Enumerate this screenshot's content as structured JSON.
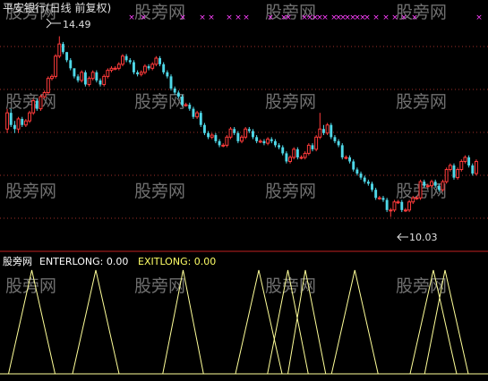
{
  "main_panel": {
    "title": "平安银行(日线 前复权)",
    "high_label": "14.49",
    "low_label": "10.03",
    "watermark": "股旁网",
    "marker_glyph": "×"
  },
  "indicator_panel": {
    "name": "股旁网",
    "enter_label": "ENTERLONG: 0.00",
    "exit_label": "EXITLONG: 0.00"
  },
  "colors": {
    "background": "#000000",
    "up_candle": "#ff3b3b",
    "down_candle": "#4fd8e8",
    "title": "#e0e0e0",
    "watermark": "#6f6f6f",
    "grid": "#a0302a",
    "panel_divider": "#c02020",
    "marker": "#ff40ff",
    "indicator_line": "#ffff99",
    "label_white": "#ffffff",
    "label_yellow": "#ffff66"
  },
  "chart_data": [
    {
      "type": "candlestick",
      "title": "平安银行(日线 前复权)",
      "y_range": [
        9.6,
        14.9
      ],
      "grid": true,
      "annotations": [
        {
          "text": "14.49",
          "value": 14.49,
          "kind": "high"
        },
        {
          "text": "10.03",
          "value": 10.03,
          "kind": "low"
        }
      ],
      "series": {
        "open": [
          12.2,
          12.6,
          12.3,
          12.2,
          12.45,
          12.3,
          12.4,
          12.6,
          12.9,
          12.7,
          13.0,
          13.1,
          13.45,
          13.5,
          14.0,
          14.3,
          14.1,
          13.9,
          13.7,
          13.5,
          13.4,
          13.6,
          13.3,
          13.45,
          13.6,
          13.4,
          13.3,
          13.5,
          13.65,
          13.7,
          13.7,
          13.8,
          14.0,
          13.9,
          13.85,
          13.6,
          13.55,
          13.6,
          13.75,
          13.7,
          13.8,
          13.95,
          13.8,
          13.6,
          13.5,
          13.2,
          13.1,
          13.0,
          12.8,
          12.8,
          12.7,
          12.5,
          12.6,
          12.3,
          12.1,
          12.0,
          12.05,
          11.9,
          11.8,
          11.8,
          12.0,
          12.2,
          12.1,
          11.9,
          12.0,
          12.2,
          12.15,
          12.0,
          11.9,
          11.9,
          11.85,
          11.95,
          11.9,
          11.8,
          11.75,
          11.6,
          11.4,
          11.5,
          11.7,
          11.5,
          11.5,
          11.6,
          11.8,
          11.7,
          12.0,
          12.2,
          12.1,
          12.3,
          12.0,
          11.9,
          11.8,
          11.5,
          11.5,
          11.4,
          11.2,
          11.1,
          11.0,
          10.9,
          10.85,
          10.7,
          10.5,
          10.5,
          10.45,
          10.2,
          10.2,
          10.4,
          10.4,
          10.2,
          10.2,
          10.4,
          10.5,
          10.5,
          10.9,
          10.8,
          10.8,
          10.9,
          10.8,
          10.7,
          10.9,
          11.2,
          11.3,
          11.0,
          11.2,
          11.4,
          11.5,
          11.3,
          11.1
        ],
        "close": [
          12.6,
          12.3,
          12.2,
          12.45,
          12.3,
          12.4,
          12.6,
          12.9,
          12.7,
          13.0,
          13.1,
          13.45,
          13.5,
          14.0,
          14.3,
          14.1,
          13.9,
          13.7,
          13.5,
          13.4,
          13.6,
          13.3,
          13.45,
          13.6,
          13.4,
          13.3,
          13.5,
          13.65,
          13.7,
          13.7,
          13.8,
          14.0,
          13.9,
          13.85,
          13.6,
          13.55,
          13.6,
          13.75,
          13.7,
          13.8,
          13.95,
          13.8,
          13.6,
          13.5,
          13.2,
          13.1,
          13.0,
          12.8,
          12.8,
          12.7,
          12.5,
          12.6,
          12.3,
          12.1,
          12.0,
          12.05,
          11.9,
          11.8,
          11.8,
          12.0,
          12.2,
          12.1,
          11.9,
          12.0,
          12.2,
          12.15,
          12.0,
          11.9,
          11.9,
          11.85,
          11.95,
          11.9,
          11.8,
          11.75,
          11.6,
          11.4,
          11.5,
          11.7,
          11.5,
          11.5,
          11.6,
          11.8,
          11.7,
          12.0,
          12.2,
          12.1,
          12.3,
          12.0,
          11.9,
          11.8,
          11.5,
          11.5,
          11.4,
          11.2,
          11.1,
          11.0,
          10.9,
          10.85,
          10.7,
          10.5,
          10.5,
          10.45,
          10.2,
          10.2,
          10.4,
          10.4,
          10.2,
          10.2,
          10.4,
          10.5,
          10.5,
          10.9,
          10.8,
          10.8,
          10.9,
          10.8,
          10.7,
          10.9,
          11.2,
          11.3,
          11.0,
          11.2,
          11.4,
          11.5,
          11.3,
          11.1,
          11.4
        ],
        "high": [
          12.7,
          12.7,
          12.4,
          12.5,
          12.5,
          12.45,
          12.65,
          12.95,
          12.95,
          13.05,
          13.15,
          13.5,
          13.55,
          14.05,
          14.49,
          14.35,
          14.1,
          13.95,
          13.7,
          13.55,
          13.65,
          13.65,
          13.5,
          13.65,
          13.65,
          13.45,
          13.55,
          13.7,
          13.75,
          13.75,
          13.85,
          14.05,
          14.05,
          13.95,
          13.9,
          13.65,
          13.65,
          13.8,
          13.8,
          13.85,
          14.0,
          14.0,
          13.85,
          13.65,
          13.55,
          13.25,
          13.15,
          13.05,
          12.85,
          12.85,
          12.75,
          12.65,
          12.65,
          12.35,
          12.15,
          12.1,
          12.1,
          11.95,
          11.85,
          12.05,
          12.25,
          12.25,
          12.15,
          12.05,
          12.25,
          12.25,
          12.2,
          12.05,
          11.95,
          11.95,
          12.0,
          12.0,
          11.95,
          11.85,
          11.8,
          11.65,
          11.55,
          11.75,
          11.75,
          11.55,
          11.65,
          11.85,
          11.85,
          12.05,
          12.6,
          12.3,
          12.35,
          12.35,
          12.05,
          11.95,
          11.85,
          11.55,
          11.55,
          11.45,
          11.25,
          11.15,
          11.05,
          10.95,
          10.9,
          10.75,
          10.55,
          10.55,
          10.5,
          10.25,
          10.45,
          10.45,
          10.45,
          10.25,
          10.45,
          10.55,
          10.55,
          10.95,
          10.95,
          10.85,
          10.95,
          10.95,
          10.85,
          10.95,
          11.25,
          11.35,
          11.35,
          11.25,
          11.45,
          11.55,
          11.55,
          11.35,
          11.45
        ],
        "low": [
          12.1,
          12.25,
          12.1,
          12.1,
          12.25,
          12.25,
          12.35,
          12.55,
          12.65,
          12.65,
          12.95,
          13.05,
          13.4,
          13.45,
          13.95,
          14.05,
          13.85,
          13.65,
          13.45,
          13.35,
          13.35,
          13.25,
          13.25,
          13.4,
          13.35,
          13.25,
          13.25,
          13.45,
          13.6,
          13.65,
          13.65,
          13.75,
          13.85,
          13.8,
          13.55,
          13.5,
          13.5,
          13.55,
          13.65,
          13.65,
          13.75,
          13.75,
          13.55,
          13.45,
          13.15,
          13.05,
          12.95,
          12.75,
          12.75,
          12.65,
          12.45,
          12.45,
          12.25,
          12.05,
          11.95,
          11.95,
          11.85,
          11.75,
          11.75,
          11.75,
          11.95,
          12.05,
          11.85,
          11.85,
          11.95,
          12.1,
          11.95,
          11.85,
          11.85,
          11.8,
          11.8,
          11.85,
          11.75,
          11.7,
          11.55,
          11.35,
          11.35,
          11.45,
          11.45,
          11.45,
          11.45,
          11.55,
          11.65,
          11.65,
          11.95,
          12.05,
          12.05,
          11.95,
          11.85,
          11.75,
          11.45,
          11.45,
          11.35,
          11.15,
          11.05,
          10.95,
          10.85,
          10.8,
          10.65,
          10.45,
          10.45,
          10.4,
          10.15,
          10.03,
          10.15,
          10.35,
          10.15,
          10.15,
          10.15,
          10.35,
          10.45,
          10.45,
          10.75,
          10.75,
          10.75,
          10.75,
          10.65,
          10.65,
          10.85,
          11.15,
          10.95,
          10.95,
          11.15,
          11.35,
          11.25,
          11.05,
          11.05
        ]
      },
      "signal_markers_count": 30
    },
    {
      "type": "line",
      "title": "",
      "series": [
        {
          "name": "ENTERLONG",
          "value": 0.0
        },
        {
          "name": "EXITLONG",
          "value": 0.0
        }
      ],
      "signal_line": {
        "y_range": [
          0,
          1
        ],
        "pulses": [
          {
            "start": 2,
            "peak": 10,
            "end": 18
          },
          {
            "start": 24,
            "peak": 32,
            "end": 40
          },
          {
            "start": 55,
            "peak": 62,
            "end": 69
          },
          {
            "start": 80,
            "peak": 88,
            "end": 96
          },
          {
            "start": 91,
            "peak": 98,
            "end": 105
          },
          {
            "start": 98,
            "peak": 104,
            "end": 111
          },
          {
            "start": 113,
            "peak": 121,
            "end": 129
          },
          {
            "start": 140,
            "peak": 148,
            "end": 156
          },
          {
            "start": 145,
            "peak": 152,
            "end": 160
          }
        ]
      }
    }
  ]
}
